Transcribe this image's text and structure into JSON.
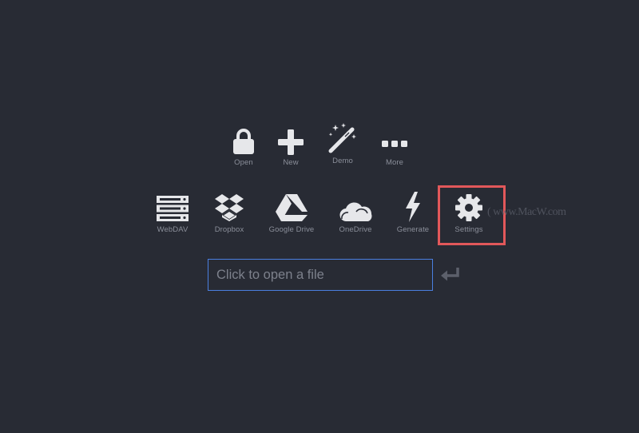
{
  "top_row": {
    "open_label": "Open",
    "new_label": "New",
    "demo_label": "Demo",
    "more_label": "More"
  },
  "services_row": {
    "webdav_label": "WebDAV",
    "dropbox_label": "Dropbox",
    "google_drive_label": "Google Drive",
    "onedrive_label": "OneDrive",
    "generate_label": "Generate",
    "settings_label": "Settings"
  },
  "file_input": {
    "placeholder": "Click to open a file",
    "value": ""
  },
  "watermark": {
    "text": "( www.MacW.com"
  },
  "colors": {
    "background": "#282b34",
    "icon": "#e6e7ea",
    "label": "#8b8f9a",
    "input_border": "#4a7fe0",
    "highlight": "#e2585a"
  }
}
